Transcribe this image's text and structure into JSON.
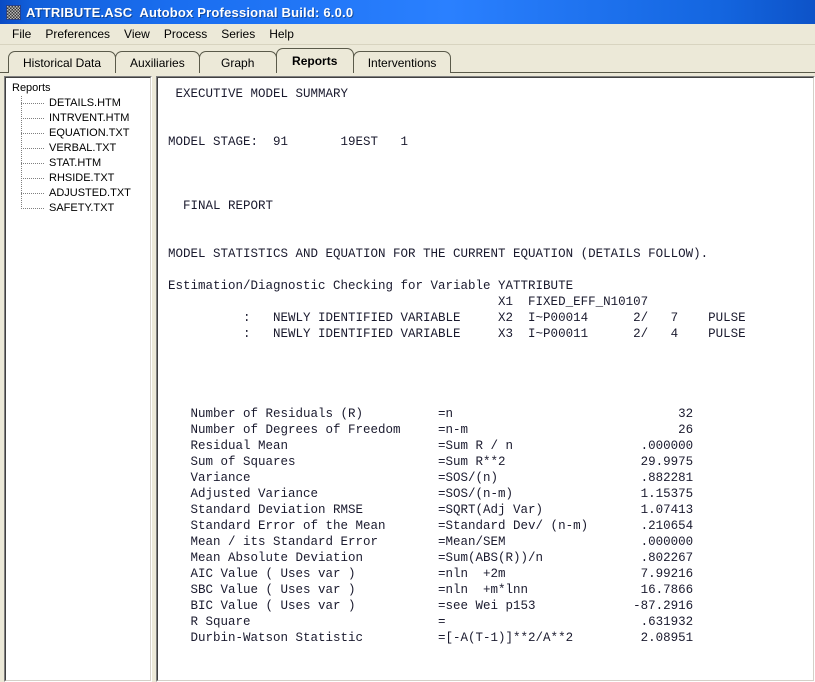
{
  "window": {
    "icon": "app-icon",
    "filename": "ATTRIBUTE.ASC",
    "app_title": "Autobox Professional Build:  6.0.0"
  },
  "menubar": {
    "items": [
      {
        "label": "File"
      },
      {
        "label": "Preferences"
      },
      {
        "label": "View"
      },
      {
        "label": "Process"
      },
      {
        "label": "Series"
      },
      {
        "label": "Help"
      }
    ]
  },
  "tabs": [
    {
      "label": "Historical Data",
      "active": false
    },
    {
      "label": "Auxiliaries",
      "active": false
    },
    {
      "label": "Graph",
      "active": false
    },
    {
      "label": "Reports",
      "active": true
    },
    {
      "label": "Interventions",
      "active": false
    }
  ],
  "sidebar": {
    "root_label": "Reports",
    "items": [
      {
        "label": "DETAILS.HTM"
      },
      {
        "label": "INTRVENT.HTM"
      },
      {
        "label": "EQUATION.TXT"
      },
      {
        "label": "VERBAL.TXT"
      },
      {
        "label": "STAT.HTM"
      },
      {
        "label": "RHSIDE.TXT"
      },
      {
        "label": "ADJUSTED.TXT"
      },
      {
        "label": "SAFETY.TXT"
      }
    ]
  },
  "report": {
    "executive_summary_heading": "EXECUTIVE MODEL SUMMARY",
    "model_stage_label": "MODEL STAGE:",
    "model_stage_value": "91",
    "model_stage_est": "19EST",
    "model_stage_num": "1",
    "final_report_heading": "FINAL REPORT",
    "statistics_heading": "MODEL STATISTICS AND EQUATION FOR THE CURRENT EQUATION (DETAILS FOLLOW).",
    "estimation_line": "Estimation/Diagnostic Checking for Variable Y",
    "estimation_variable": "ATTRIBUTE",
    "variables": [
      {
        "prefix": "",
        "note": "",
        "code": "X1",
        "name": "FIXED_EFF_N10107",
        "ratio": "",
        "count": "",
        "type": ""
      },
      {
        "prefix": ":",
        "note": "NEWLY IDENTIFIED VARIABLE",
        "code": "X2",
        "name": "I~P00014",
        "ratio": "2/",
        "count": "7",
        "type": "PULSE"
      },
      {
        "prefix": ":",
        "note": "NEWLY IDENTIFIED VARIABLE",
        "code": "X3",
        "name": "I~P00011",
        "ratio": "2/",
        "count": "4",
        "type": "PULSE"
      }
    ],
    "stats": [
      {
        "label": "Number of Residuals (R)",
        "formula": "=n",
        "value": "32"
      },
      {
        "label": "Number of Degrees of Freedom",
        "formula": "=n-m",
        "value": "26"
      },
      {
        "label": "Residual Mean",
        "formula": "=Sum R / n",
        "value": ".000000"
      },
      {
        "label": "Sum of Squares",
        "formula": "=Sum R**2",
        "value": "29.9975"
      },
      {
        "label": "Variance",
        "formula": "=SOS/(n)",
        "value": ".882281"
      },
      {
        "label": "Adjusted Variance",
        "formula": "=SOS/(n-m)",
        "value": "1.15375"
      },
      {
        "label": "Standard Deviation RMSE",
        "formula": "=SQRT(Adj Var)",
        "value": "1.07413"
      },
      {
        "label": "Standard Error of the Mean",
        "formula": "=Standard Dev/ (n-m)",
        "value": ".210654"
      },
      {
        "label": "Mean / its Standard Error",
        "formula": "=Mean/SEM",
        "value": ".000000"
      },
      {
        "label": "Mean Absolute Deviation",
        "formula": "=Sum(ABS(R))/n",
        "value": ".802267"
      },
      {
        "label": "AIC Value ( Uses var )",
        "formula": "=nln  +2m",
        "value": "7.99216"
      },
      {
        "label": "SBC Value ( Uses var )",
        "formula": "=nln  +m*lnn",
        "value": "16.7866"
      },
      {
        "label": "BIC Value ( Uses var )",
        "formula": "=see Wei p153",
        "value": "-87.2916"
      },
      {
        "label": "R Square",
        "formula": "=",
        "value": ".631932"
      },
      {
        "label": "Durbin-Watson Statistic",
        "formula": "=[-A(T-1)]**2/A**2",
        "value": "2.08951"
      }
    ]
  }
}
